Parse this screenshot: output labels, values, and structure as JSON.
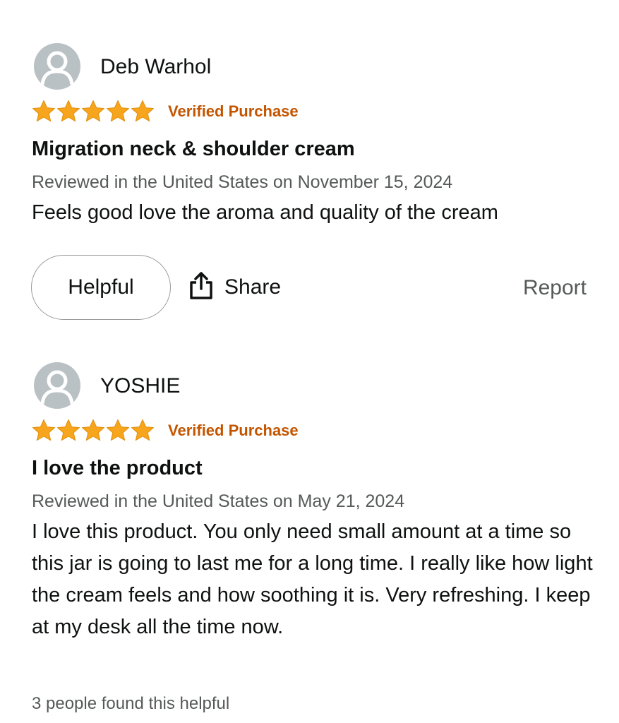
{
  "colors": {
    "star": "#f7a51c",
    "verified": "#c45500",
    "avatar_bg": "#b9c1c4",
    "secondary_text": "#565959"
  },
  "reviews": [
    {
      "reviewer": "Deb Warhol",
      "avatar_icon": "person-icon",
      "rating": 5,
      "rating_max": 5,
      "verified": "Verified Purchase",
      "title": "Migration neck & shoulder cream",
      "date": "Reviewed in the United States on November 15, 2024",
      "body": "Feels good love the aroma and quality of the cream",
      "actions": {
        "helpful": "Helpful",
        "share": "Share",
        "share_icon": "share-icon",
        "report": "Report"
      }
    },
    {
      "reviewer": "YOSHIE",
      "avatar_icon": "person-icon",
      "rating": 5,
      "rating_max": 5,
      "verified": "Verified Purchase",
      "title": "I love the product",
      "date": "Reviewed in the United States on May 21, 2024",
      "body": "I love this product. You only need small amount at a time so this jar is going to last me for a long time. I really like how light the cream feels and how soothing it is. Very refreshing. I keep at my desk all the time now.",
      "helpful_count": "3 people found this helpful"
    }
  ]
}
